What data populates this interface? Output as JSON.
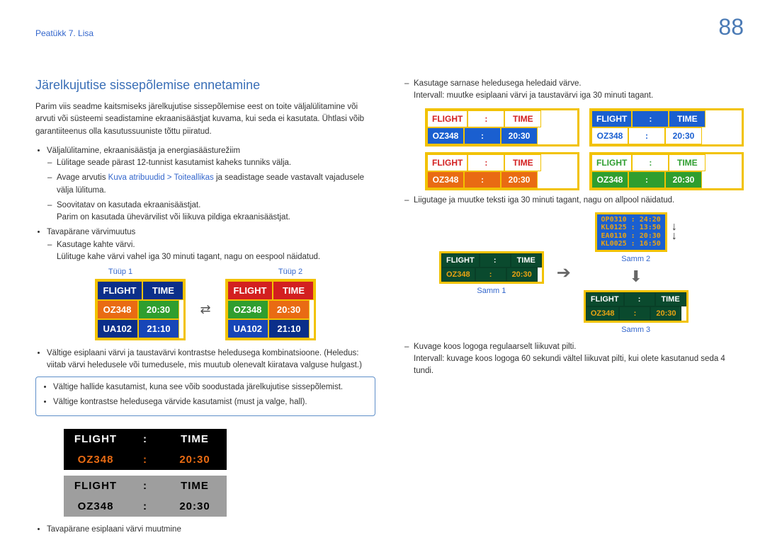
{
  "breadcrumb": "Peatükk 7. Lisa",
  "page_number": "88",
  "left": {
    "title": "Järelkujutise sissepõlemise ennetamine",
    "intro": "Parim viis seadme kaitsmiseks järelkujutise sissepõlemise eest on toite väljalülitamine või arvuti või süsteemi seadistamine ekraanisäästjat kuvama, kui seda ei kasutata. Ühtlasi võib garantiiteenus olla kasutussuuniste tõttu piiratud.",
    "b1": "Väljalülitamine, ekraanisäästja ja energiasäästurežiim",
    "d1": "Lülitage seade pärast 12-tunnist kasutamist kaheks tunniks välja.",
    "d2a": "Avage arvutis ",
    "d2link1": "Kuva atribuudid",
    "d2sep": " > ",
    "d2link2": "Toiteallikas",
    "d2b": " ja seadistage seade vastavalt vajadusele välja lülituma.",
    "d3a": "Soovitatav on kasutada ekraanisäästjat.",
    "d3b": "Parim on kasutada ühevärvilist või liikuva pildiga ekraanisäästjat.",
    "b2": "Tavapärane värvimuutus",
    "d4a": "Kasutage kahte värvi.",
    "d4b": "Lülituge kahe värvi vahel iga 30 minuti tagant, nagu on eespool näidatud.",
    "type1": "Tüüp 1",
    "type2": "Tüüp 2",
    "board": {
      "h1": "FLIGHT",
      "h2": "TIME",
      "r1a": "OZ348",
      "r1b": "20:30",
      "r2a": "UA102",
      "r2b": "21:10"
    },
    "b3": "Vältige esiplaani värvi ja taustavärvi kontrastse heledusega kombinatsioone. (Heledus: viitab värvi heledusele või tumedusele, mis muutub olenevalt kiiratava valguse hulgast.)",
    "box1": "Vältige hallide kasutamist, kuna see võib soodustada järelkujutise sissepõlemist.",
    "box2": "Vältige kontrastse heledusega värvide kasutamist (must ja valge, hall).",
    "slab": {
      "h1": "FLIGHT",
      "h2": "TIME",
      "v1": "OZ348",
      "v2": "20:30"
    },
    "b4": "Tavapärane esiplaani värvi muutmine"
  },
  "right": {
    "d1a": "Kasutage sarnase heledusega heledaid värve.",
    "d1b": "Intervall: muutke esiplaani värvi ja taustavärvi iga 30 minuti tagant.",
    "mini": {
      "h1": "FLIGHT",
      "h2": "TIME",
      "v1": "OZ348",
      "v2": "20:30"
    },
    "d2": "Liigutage ja muutke teksti iga 30 minuti tagant, nagu on allpool näidatud.",
    "step1": "Samm 1",
    "step2": "Samm 2",
    "step3": "Samm 3",
    "scroll": {
      "l1": "OP0310  :  24:20",
      "l2": "KL0125  :  13:50",
      "l3": "EA0110  :  20:30",
      "l4": "KL0025  :  16:50"
    },
    "d3a": "Kuvage koos logoga regulaarselt liikuvat pilti.",
    "d3b": "Intervall: kuvage koos logoga 60 sekundi vältel liikuvat pilti, kui olete kasutanud seda 4 tundi."
  }
}
